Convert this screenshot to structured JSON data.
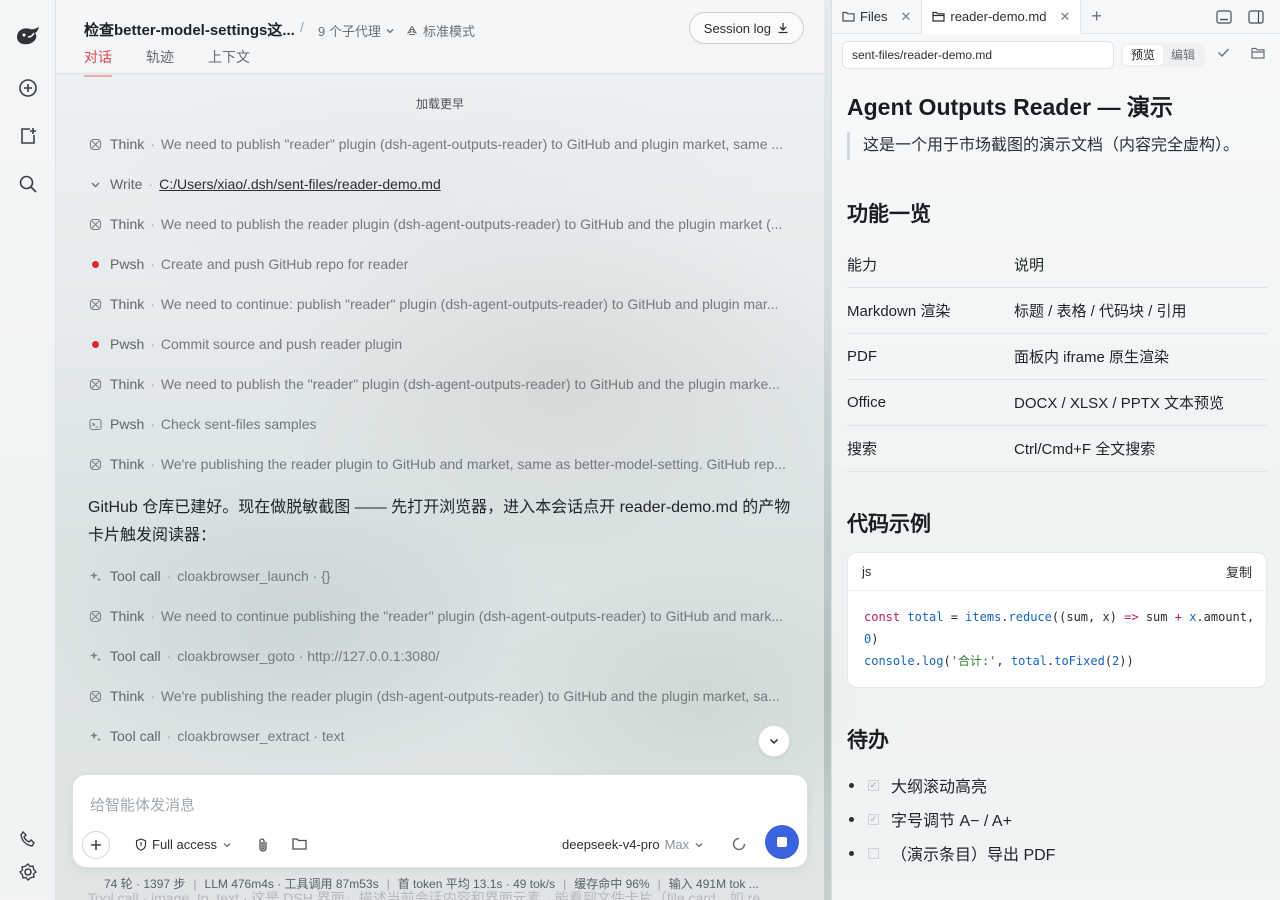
{
  "rail": {
    "icons": [
      "whale-logo-icon",
      "new-chat-icon",
      "add-file-icon",
      "search-icon",
      "phone-icon",
      "settings-icon"
    ]
  },
  "header": {
    "title": "检查better-model-settings这...",
    "separator": "/",
    "agents": "9 个子代理",
    "mode": "标准模式",
    "session_log": "Session log",
    "tabs": [
      "对话",
      "轨迹",
      "上下文"
    ]
  },
  "chat": {
    "load_more": "加载更早",
    "steps": [
      {
        "icon": "think-icon",
        "kind": "Think",
        "text": "We need to publish \"reader\" plugin (dsh-agent-outputs-reader) to GitHub and plugin market, same ..."
      },
      {
        "icon": "chevron-down-icon",
        "kind": "Write",
        "text": "C:/Users/xiao/.dsh/sent-files/reader-demo.md"
      },
      {
        "icon": "think-icon",
        "kind": "Think",
        "text": "We need to publish the reader plugin (dsh-agent-outputs-reader) to GitHub and the plugin market (..."
      },
      {
        "icon": "red-dot-icon",
        "kind": "Pwsh",
        "text": "Create and push GitHub repo for reader"
      },
      {
        "icon": "think-icon",
        "kind": "Think",
        "text": "We need to continue: publish \"reader\" plugin (dsh-agent-outputs-reader) to GitHub and plugin mar..."
      },
      {
        "icon": "red-dot-icon",
        "kind": "Pwsh",
        "text": "Commit source and push reader plugin"
      },
      {
        "icon": "think-icon",
        "kind": "Think",
        "text": "We need to publish the \"reader\" plugin (dsh-agent-outputs-reader) to GitHub and the plugin marke..."
      },
      {
        "icon": "terminal-icon",
        "kind": "Pwsh",
        "text": "Check sent-files samples"
      },
      {
        "icon": "think-icon",
        "kind": "Think",
        "text": "We're publishing the reader plugin to GitHub and market, same as better-model-setting. GitHub rep..."
      }
    ],
    "paragraph": "GitHub 仓库已建好。现在做脱敏截图 —— 先打开浏览器，进入本会话点开 reader-demo.md 的产物卡片触发阅读器：",
    "steps2": [
      {
        "icon": "sparkle-icon",
        "kind": "Tool call",
        "text": "cloakbrowser_launch · {}"
      },
      {
        "icon": "think-icon",
        "kind": "Think",
        "text": "We need to continue publishing the \"reader\" plugin (dsh-agent-outputs-reader) to GitHub and mark..."
      },
      {
        "icon": "sparkle-icon",
        "kind": "Tool call",
        "text": "cloakbrowser_goto · http://127.0.0.1:3080/"
      },
      {
        "icon": "think-icon",
        "kind": "Think",
        "text": "We're publishing the reader plugin (dsh-agent-outputs-reader) to GitHub and the plugin market, sa..."
      },
      {
        "icon": "sparkle-icon",
        "kind": "Tool call",
        "text": "cloakbrowser_extract · text"
      }
    ],
    "faded_line": "Tool call · image_to_text · 这是 DSH 界面。描述当前会话内容和界面元素，能看到文件卡片（file card，如 re..."
  },
  "composer": {
    "placeholder": "给智能体发消息",
    "access": "Full access",
    "model": "deepseek-v4-pro",
    "level": "Max"
  },
  "stats": [
    "74 轮 · 1397 步",
    "LLM 476m4s · 工具调用 87m53s",
    "首 token 平均 13.1s · 49 tok/s",
    "缓存命中 96%",
    "输入 491M tok ..."
  ],
  "panel": {
    "tabs": [
      {
        "label": "Files",
        "icon": "folder-icon"
      },
      {
        "label": "reader-demo.md",
        "icon": "folder-open-icon"
      }
    ],
    "path": "sent-files/reader-demo.md",
    "preview": "预览",
    "edit": "编辑",
    "doc": {
      "title": "Agent Outputs Reader — 演示",
      "quote": "这是一个用于市场截图的演示文档（内容完全虚构）。",
      "h_features": "功能一览",
      "table_head": [
        "能力",
        "说明"
      ],
      "table_rows": [
        [
          "Markdown 渲染",
          "标题 / 表格 / 代码块 / 引用"
        ],
        [
          "PDF",
          "面板内 iframe 原生渲染"
        ],
        [
          "Office",
          "DOCX / XLSX / PPTX 文本预览"
        ],
        [
          "搜索",
          "Ctrl/Cmd+F 全文搜索"
        ]
      ],
      "h_code": "代码示例",
      "code_lang": "js",
      "code_copy": "复制",
      "h_todo": "待办",
      "todos": [
        {
          "text": "大纲滚动高亮",
          "done": true
        },
        {
          "text": "字号调节 A− / A+",
          "done": true
        },
        {
          "text": "（演示条目）导出 PDF",
          "done": false
        }
      ]
    }
  }
}
